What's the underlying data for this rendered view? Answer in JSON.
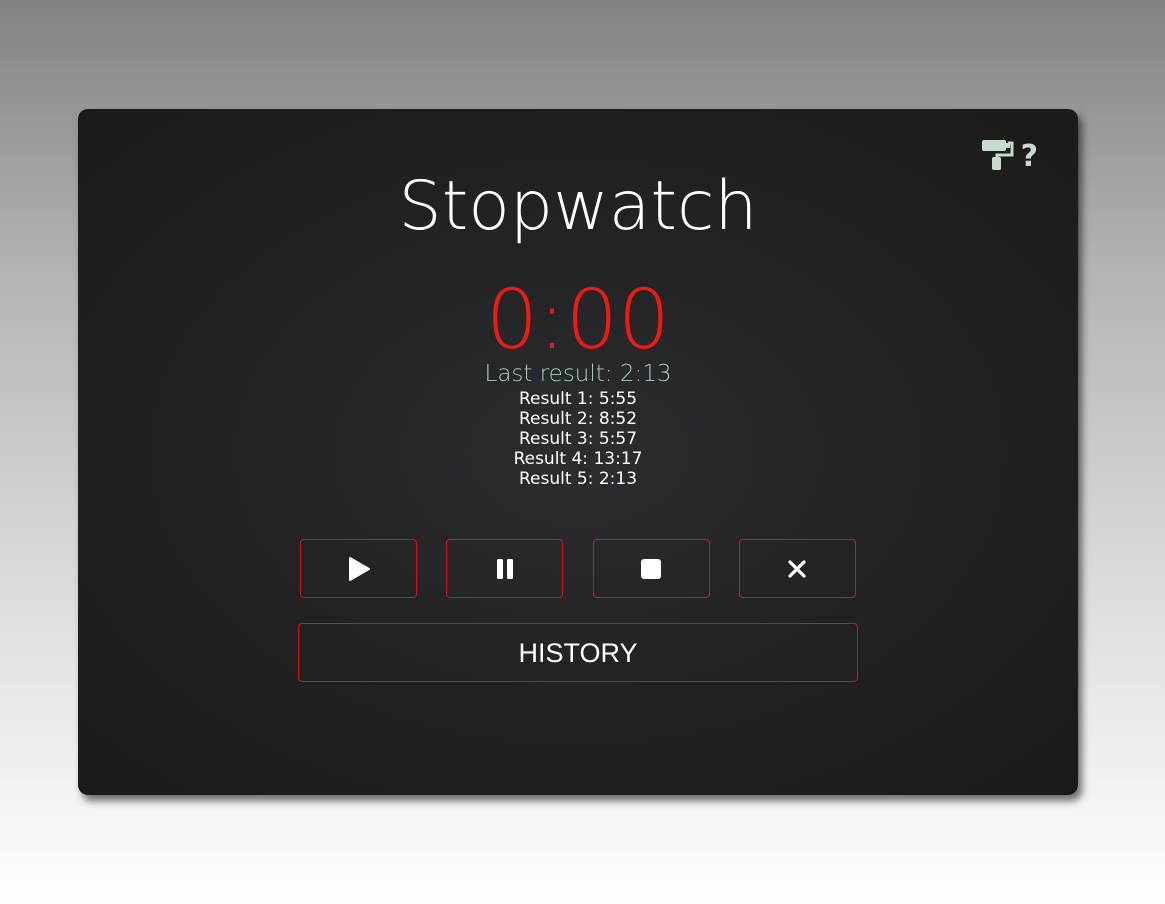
{
  "app": {
    "title": "Stopwatch",
    "time": "0:00",
    "last_result": "Last result: 2:13"
  },
  "results": [
    "Result 1: 5:55",
    "Result 2: 8:52",
    "Result 3: 5:57",
    "Result 4: 13:17",
    "Result 5: 2:13"
  ],
  "toolbar": {
    "theme_icon": "paint-roller-icon",
    "help_label": "?"
  },
  "controls": {
    "play_icon": "play-icon",
    "pause_icon": "pause-icon",
    "stop_icon": "stop-icon",
    "reset_icon": "close-icon",
    "history_label": "HISTORY"
  },
  "colors": {
    "accent": "#ef1a12",
    "button_border": "#d2190f",
    "muted_text": "#a9cdb7",
    "icon_tint": "#c5dccc",
    "card_background": "#222224"
  }
}
